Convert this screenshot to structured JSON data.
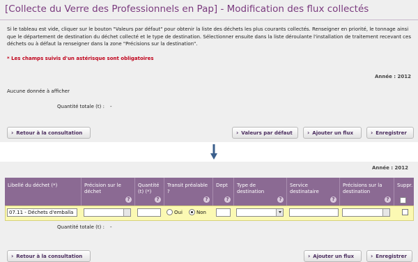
{
  "header": {
    "title": "[Collecte du Verre des Professionnels en Pap] - Modification des flux collectés"
  },
  "intro": {
    "text": "Si le tableau est vide, cliquer sur le bouton \"Valeurs par défaut\" pour obtenir la liste des déchets les plus courants collectés. Renseigner en priorité, le tonnage ainsi que le département de destination du déchet collecté et le type de destination. Sélectionner ensuite dans la liste déroulante l'installation de traitement recevant ces déchets ou à défaut la renseigner dans la zone \"Précisions sur la destination\".",
    "mandatory": "* Les champs suivis d'un astérisque sont obligatoires"
  },
  "before": {
    "year": "Année : 2012",
    "empty_message": "Aucune donnée à afficher",
    "quantity_label": "Quantité totale (t) :",
    "quantity_value": "-",
    "buttons": {
      "back": "Retour à la consultation",
      "defaults": "Valeurs par défaut",
      "add": "Ajouter un flux",
      "save": "Enregistrer"
    }
  },
  "after": {
    "year": "Année : 2012",
    "columns": [
      "Libellé du déchet (*)",
      "Précision sur le déchet",
      "Quantité (t) (*)",
      "Transit préalable ?",
      "Dept",
      "Type de destination",
      "Service destinataire",
      "Précisions sur la destination",
      "Suppr."
    ],
    "row": {
      "waste_label": "07.11 - Déchets d'emballa",
      "precision": "",
      "quantity": "",
      "transit_yes": "Oui",
      "transit_no": "Non",
      "transit_selected": "Non",
      "dept": "",
      "destination_type": "",
      "service": "",
      "destination_precision": "",
      "delete_checked": false
    },
    "quantity_label": "Quantité totale (t) :",
    "quantity_value": "-",
    "buttons": {
      "back": "Retour à la consultation",
      "add": "Ajouter un flux",
      "save": "Enregistrer"
    }
  },
  "icons": {
    "button_chevron": "chevron-right-icon",
    "help": "help-icon",
    "transition_arrow": "arrow-down-icon"
  },
  "colors": {
    "title": "#7a3a7e",
    "mandatory": "#c0001a",
    "table_header": "#8b6a93",
    "row_highlight": "#fbf9b3",
    "arrow": "#3b5f8c"
  }
}
